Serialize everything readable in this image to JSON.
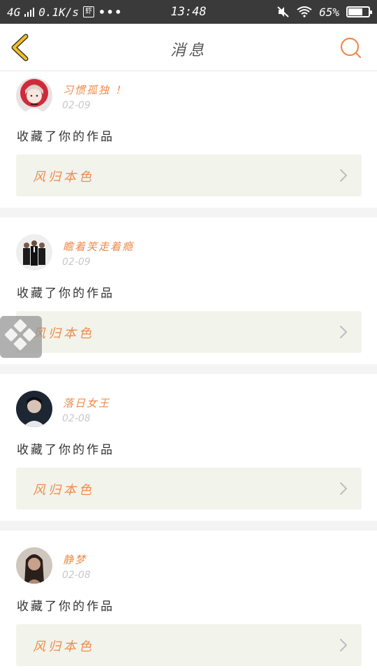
{
  "status_bar": {
    "network": "4G",
    "speed": "0.1K/s",
    "app_glyph": "虾",
    "more": "•••",
    "time": "13:48",
    "battery_text": "65%",
    "battery_level": 0.65,
    "icons": [
      "signal-icon",
      "mute-icon",
      "wifi-icon",
      "battery-icon"
    ]
  },
  "header": {
    "title": "消息",
    "back_icon": "chevron-left-icon",
    "search_icon": "search-icon",
    "accent_color": "#f08a4b",
    "back_color": "#f5c11e"
  },
  "messages": [
    {
      "username": "习惯孤独 ！",
      "date": "02-09",
      "action": "收藏了你的作品",
      "work_title": "风归本色",
      "avatar_icon": "avatar-anime-girl"
    },
    {
      "username": "瞻着笑走着瘾",
      "date": "02-09",
      "action": "收藏了你的作品",
      "work_title": "风归本色",
      "avatar_icon": "avatar-group-suits"
    },
    {
      "username": "落日女王",
      "date": "02-08",
      "action": "收藏了你的作品",
      "work_title": "风归本色",
      "avatar_icon": "avatar-person-dark"
    },
    {
      "username": "静梦",
      "date": "02-08",
      "action": "收藏了你的作品",
      "work_title": "风归本色",
      "avatar_icon": "avatar-person-long-hair"
    }
  ],
  "floating_widget": {
    "icon": "assistive-touch-icon"
  }
}
